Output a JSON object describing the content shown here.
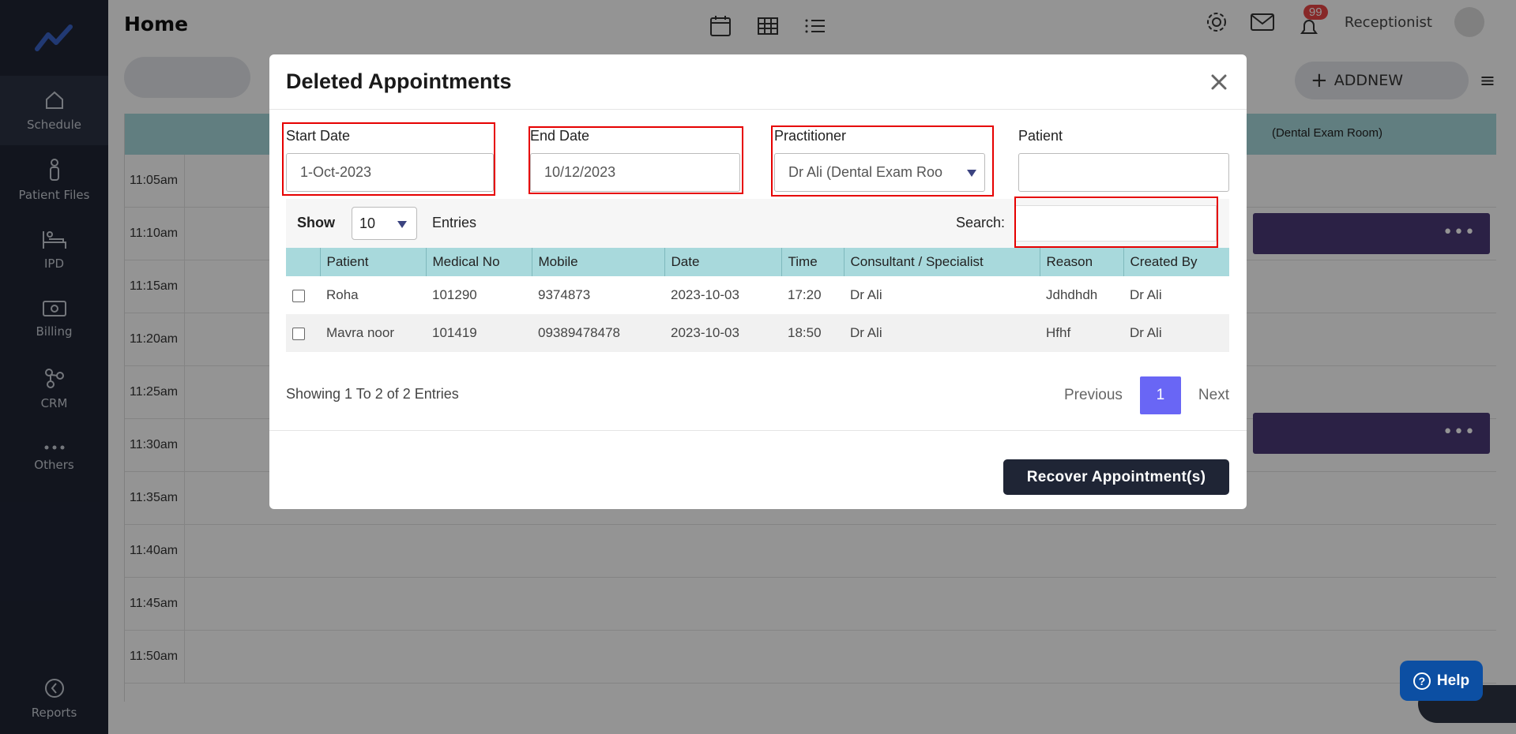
{
  "app": {
    "page_title": "Home",
    "role": "Receptionist",
    "notifications": "99"
  },
  "sidebar": {
    "items": [
      {
        "label": "Schedule",
        "icon": "home-icon"
      },
      {
        "label": "Patient Files",
        "icon": "person-icon"
      },
      {
        "label": "IPD",
        "icon": "bed-icon"
      },
      {
        "label": "Billing",
        "icon": "money-icon"
      },
      {
        "label": "CRM",
        "icon": "crm-icon"
      },
      {
        "label": "Others",
        "icon": "dots-icon"
      }
    ],
    "reports": "Reports"
  },
  "toolbar": {
    "addnew": "ADDNEW"
  },
  "calendar": {
    "room": "(Dental Exam Room)",
    "times": [
      "11:05am",
      "11:10am",
      "11:15am",
      "11:20am",
      "11:25am",
      "11:30am",
      "11:35am",
      "11:40am",
      "11:45am",
      "11:50am"
    ]
  },
  "modal": {
    "title": "Deleted Appointments",
    "start_date_label": "Start Date",
    "start_date_value": "1-Oct-2023",
    "end_date_label": "End Date",
    "end_date_value": "10/12/2023",
    "practitioner_label": "Practitioner",
    "practitioner_value": "Dr Ali (Dental Exam Roo",
    "patient_label": "Patient",
    "patient_value": "",
    "show_label": "Show",
    "page_size": "10",
    "entries_label": "Entries",
    "search_label": "Search:",
    "columns": [
      "Patient",
      "Medical No",
      "Mobile",
      "Date",
      "Time",
      "Consultant / Specialist",
      "Reason",
      "Created By"
    ],
    "rows": [
      {
        "patient": "Roha",
        "medical_no": "101290",
        "mobile": "9374873",
        "date": "2023-10-03",
        "time": "17:20",
        "consultant": "Dr Ali",
        "reason": "Jdhdhdh",
        "created_by": "Dr Ali"
      },
      {
        "patient": "Mavra noor",
        "medical_no": "101419",
        "mobile": "09389478478",
        "date": "2023-10-03",
        "time": "18:50",
        "consultant": "Dr Ali",
        "reason": "Hfhf",
        "created_by": "Dr Ali"
      }
    ],
    "showing_text": "Showing 1 To 2 of 2 Entries",
    "previous": "Previous",
    "current_page": "1",
    "next": "Next",
    "recover_button": "Recover Appointment(s)"
  },
  "help": {
    "label": "Help"
  }
}
